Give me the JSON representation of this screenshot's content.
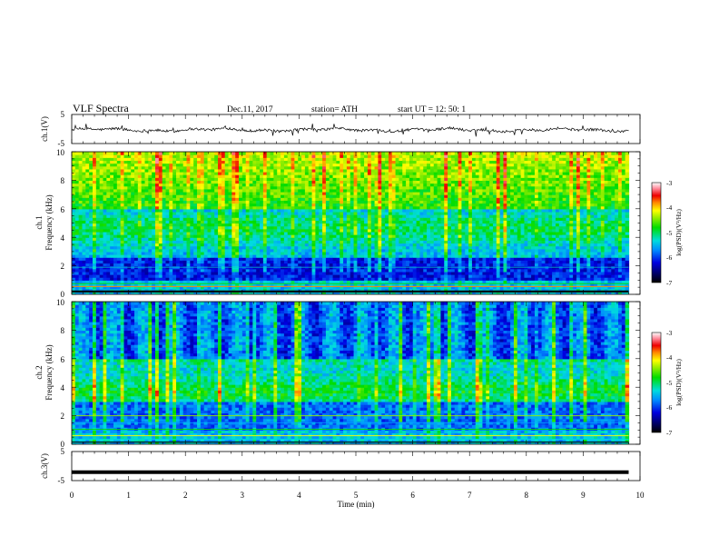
{
  "header": {
    "title": "VLF  Spectra",
    "date": "Dec.11, 2017",
    "station": "station= ATH",
    "start_ut": "start  UT  =    12: 50: 1"
  },
  "chart_data": {
    "type": "heatmap",
    "x_axis": {
      "label": "Time  (min)",
      "range": [
        0,
        10
      ],
      "ticks": [
        "0",
        "1",
        "2",
        "3",
        "4",
        "5",
        "6",
        "7",
        "8",
        "9",
        "10"
      ]
    },
    "panels": [
      {
        "id": "ch1-waveform",
        "kind": "waveform",
        "ylabel": "ch.1(V)",
        "ylim": [
          -5,
          5
        ],
        "yticks": [
          "5",
          "-5"
        ],
        "baseline": -0.3,
        "data_end_min": 9.8
      },
      {
        "id": "ch1-spectrogram",
        "kind": "spectrogram",
        "ylabel_top": "ch.1",
        "ylabel": "Frequency  (kHz)",
        "ylim": [
          0,
          10
        ],
        "yticks": [
          "0",
          "2",
          "4",
          "6",
          "8",
          "10"
        ],
        "data_end_min": 9.8,
        "colorbar": {
          "label": "log(PSD)(V²/Hz)",
          "range": [
            -7,
            -3
          ],
          "ticks": [
            "-3",
            "-4",
            "-5",
            "-6",
            "-7"
          ]
        }
      },
      {
        "id": "ch2-spectrogram",
        "kind": "spectrogram",
        "ylabel_top": "ch.2",
        "ylabel": "Frequency  (kHz)",
        "ylim": [
          0,
          10
        ],
        "yticks": [
          "0",
          "2",
          "4",
          "6",
          "8",
          "10"
        ],
        "data_end_min": 9.8,
        "colorbar": {
          "label": "log(PSD)(V²/Hz)",
          "range": [
            -7,
            -3
          ],
          "ticks": [
            "-3",
            "-4",
            "-5",
            "-6",
            "-7"
          ]
        }
      },
      {
        "id": "ch3-waveform",
        "kind": "waveform",
        "ylabel": "ch.3(V)",
        "ylim": [
          -5,
          5
        ],
        "yticks": [
          "5",
          "-5"
        ],
        "baseline": -2.1,
        "data_end_min": 9.8
      }
    ]
  }
}
